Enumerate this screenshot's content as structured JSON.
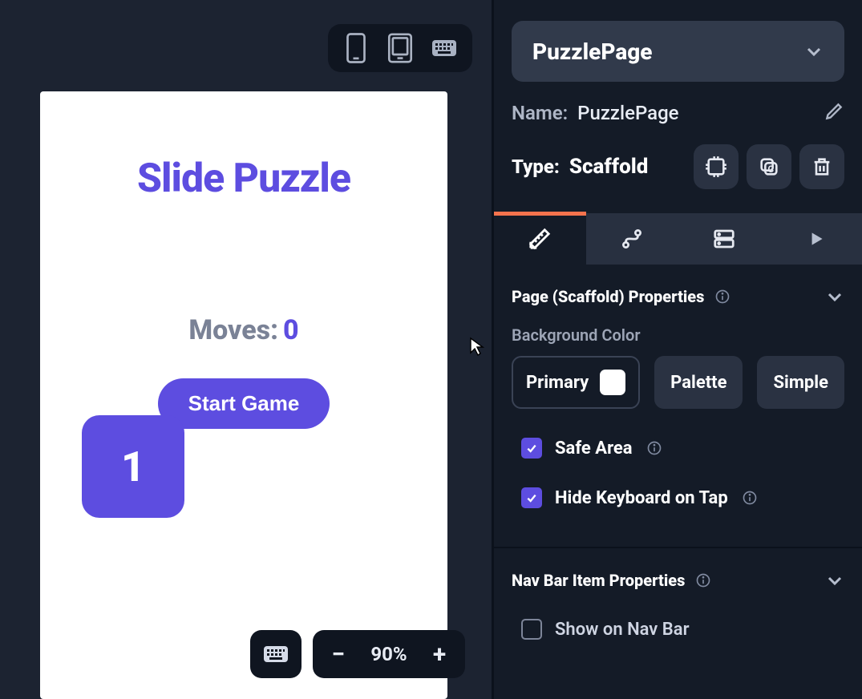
{
  "canvas": {
    "device_toggle": {
      "phone_icon": "smartphone-icon",
      "tablet_icon": "tablet-icon",
      "keyboard_icon": "keyboard-icon"
    },
    "preview": {
      "title": "Slide Puzzle",
      "moves_label": "Moves:",
      "moves_count": "0",
      "start_button": "Start Game",
      "tile_value": "1"
    },
    "zoom": {
      "value": "90%",
      "minus": "−",
      "plus": "+"
    }
  },
  "panel": {
    "page_selector": "PuzzlePage",
    "name_label": "Name:",
    "name_value": "PuzzlePage",
    "type_label": "Type:",
    "type_value": "Scaffold",
    "tabs": [
      "design",
      "actions",
      "data",
      "run"
    ],
    "section1": {
      "title": "Page (Scaffold) Properties",
      "bg_label": "Background Color",
      "color_name": "Primary",
      "color_hex": "#ffffff",
      "palette_btn": "Palette",
      "simple_btn": "Simple",
      "safe_area_label": "Safe Area",
      "safe_area_checked": true,
      "hide_kbd_label": "Hide Keyboard on Tap",
      "hide_kbd_checked": true
    },
    "section2": {
      "title": "Nav Bar Item Properties",
      "show_navbar_label": "Show on Nav Bar",
      "show_navbar_checked": false
    }
  }
}
